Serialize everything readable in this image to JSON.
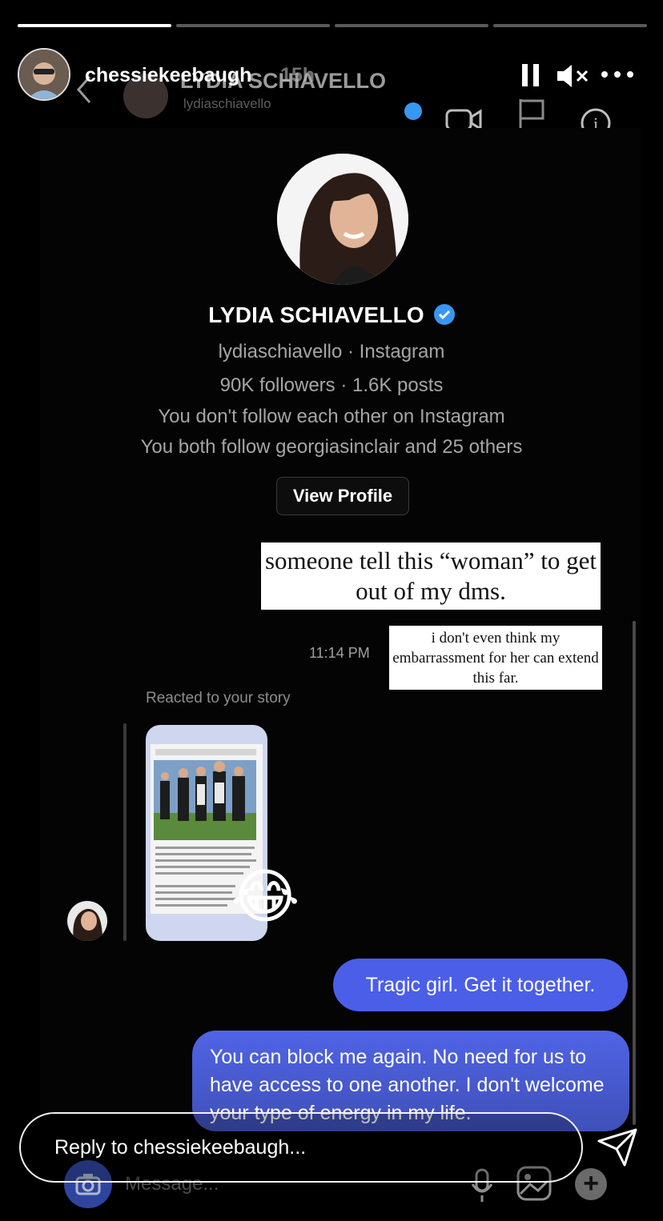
{
  "story": {
    "progress": [
      1.0,
      0.0,
      0.0,
      0.0
    ],
    "username": "chessiekeebaugh",
    "time_ago": "15h",
    "pause_icon": "pause-icon",
    "mute_icon": "speaker-muted-icon",
    "more_icon": "more-dots-icon"
  },
  "dm_header": {
    "name": "LYDIA SCHIAVELLO",
    "handle": "lydiaschiavello",
    "back_icon": "chevron-left-icon",
    "video_icon": "video-camera-icon",
    "flag_icon": "flag-icon",
    "info_icon": "info-icon"
  },
  "profile": {
    "name": "LYDIA SCHIAVELLO",
    "verified": true,
    "handle_line": "lydiaschiavello · Instagram",
    "stats_line": "90K followers · 1.6K posts",
    "follow_line": "You don't follow each other on Instagram",
    "mutual_line": "You both follow georgiasinclair and 25 others",
    "view_profile": "View Profile"
  },
  "captions": {
    "first": "someone tell this “woman” to get out of my dms.",
    "second": "i don't even think my embarrassment for her can extend this far."
  },
  "thread": {
    "timestamp": "11:14 PM",
    "reacted_label": "Reacted to your story",
    "reaction_emoji": "😂",
    "messages": [
      "Tragic girl. Get it together.",
      "You can block me again. No need for us to have access to one another. I don't welcome your type of energy in my life."
    ]
  },
  "composer": {
    "placeholder": "Message...",
    "camera_icon": "camera-icon",
    "mic_icon": "microphone-icon",
    "gallery_icon": "gallery-icon",
    "plus_icon": "plus-icon"
  },
  "reply": {
    "placeholder": "Reply to chessiekeebaugh...",
    "send_icon": "send-icon"
  },
  "colors": {
    "bubble": "#4b5ee8",
    "verified": "#3897f0"
  }
}
